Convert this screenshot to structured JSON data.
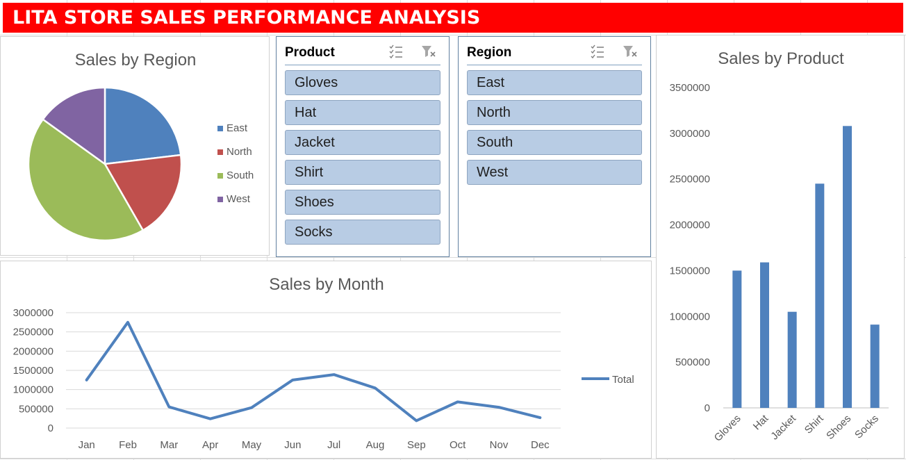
{
  "header": {
    "title": "LITA STORE SALES PERFORMANCE ANALYSIS"
  },
  "slicers": {
    "product": {
      "title": "Product",
      "items": [
        "Gloves",
        "Hat",
        "Jacket",
        "Shirt",
        "Shoes",
        "Socks"
      ],
      "multi_select_icon": "multi-select-icon",
      "clear_filter_icon": "clear-filter-icon"
    },
    "region": {
      "title": "Region",
      "items": [
        "East",
        "North",
        "South",
        "West"
      ],
      "multi_select_icon": "multi-select-icon",
      "clear_filter_icon": "clear-filter-icon"
    }
  },
  "chart_data": [
    {
      "id": "region",
      "type": "pie",
      "title": "Sales by Region",
      "categories": [
        "East",
        "North",
        "South",
        "West"
      ],
      "values": [
        2300000,
        1850000,
        4300000,
        1500000
      ],
      "colors": [
        "#4f81bd",
        "#c0504d",
        "#9bbb59",
        "#8064a2"
      ],
      "legend": "right"
    },
    {
      "id": "month",
      "type": "line",
      "title": "Sales by Month",
      "categories": [
        "Jan",
        "Feb",
        "Mar",
        "Apr",
        "May",
        "Jun",
        "Jul",
        "Aug",
        "Sep",
        "Oct",
        "Nov",
        "Dec"
      ],
      "series": [
        {
          "name": "Total",
          "values": [
            1250000,
            2750000,
            550000,
            240000,
            530000,
            1250000,
            1390000,
            1040000,
            190000,
            680000,
            540000,
            270000
          ]
        }
      ],
      "ylim": [
        0,
        3000000
      ],
      "yticks": [
        "0",
        "500000",
        "1000000",
        "1500000",
        "2000000",
        "2500000",
        "3000000"
      ],
      "grid": true,
      "color": "#4f81bd",
      "legend": "right"
    },
    {
      "id": "product",
      "type": "bar",
      "title": "Sales by Product",
      "categories": [
        "Gloves",
        "Hat",
        "Jacket",
        "Shirt",
        "Shoes",
        "Socks"
      ],
      "values": [
        1500000,
        1590000,
        1050000,
        2450000,
        3080000,
        910000
      ],
      "ylim": [
        0,
        3500000
      ],
      "yticks": [
        "0",
        "500000",
        "1000000",
        "1500000",
        "2000000",
        "2500000",
        "3000000",
        "3500000"
      ],
      "grid": false,
      "color": "#4f81bd"
    }
  ]
}
